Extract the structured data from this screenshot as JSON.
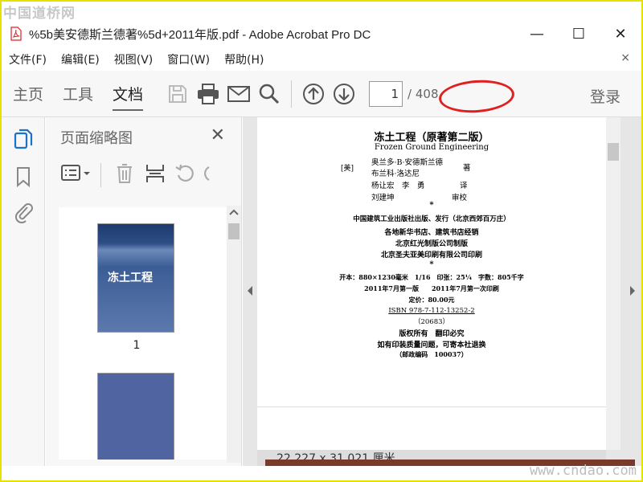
{
  "watermark_top": "中国道桥网",
  "watermark_bottom": "www.cndao.com",
  "window": {
    "title": "%5b美安德斯兰德著%5d+2011年版.pdf - Adobe Acrobat Pro DC",
    "min": "—",
    "max": "☐",
    "close": "✕"
  },
  "menu": {
    "items": [
      "文件(F)",
      "编辑(E)",
      "视图(V)",
      "窗口(W)",
      "帮助(H)"
    ],
    "close": "×"
  },
  "toolbar": {
    "tabs": [
      "主页",
      "工具",
      "文档"
    ],
    "page_current": "1",
    "page_total": "/ 408",
    "login": "登录"
  },
  "panel": {
    "title": "页面缩略图",
    "close": "✕",
    "thumb1_title": "冻土工程",
    "thumb1_num": "1"
  },
  "doc": {
    "title": "冻土工程（原著第二版）",
    "subtitle": "Frozen Ground Engineering",
    "country": "[美]",
    "authors": [
      "奥兰多·B·安德斯兰德",
      "布兰科·洛达尼"
    ],
    "author_role": "著",
    "translators": "杨让宏　李　勇",
    "translator_role": "译",
    "reviewer": "刘建坤",
    "reviewer_role": "审校",
    "star": "*",
    "publisher": "中国建筑工业出版社出版、发行（北京西郊百万庄）",
    "sellers": "各地新华书店、建筑书店经销",
    "typeset": "北京红光制版公司制版",
    "printer": "北京圣夫亚美印刷有限公司印刷",
    "spec": "开本：880×1230毫米　1/16　印张：25¼　字数：805千字",
    "edition": "2011年7月第一版　　2011年7月第一次印刷",
    "price": "定价：80.00元",
    "isbn": "ISBN 978-7-112-13252-2",
    "code": "（20683）",
    "rights": "版权所有　翻印必究",
    "notice": "如有印装质量问题，可寄本社退换",
    "postcode": "（邮政编码　100037）"
  },
  "status": {
    "size": "22.227 x 31.021 厘米"
  }
}
